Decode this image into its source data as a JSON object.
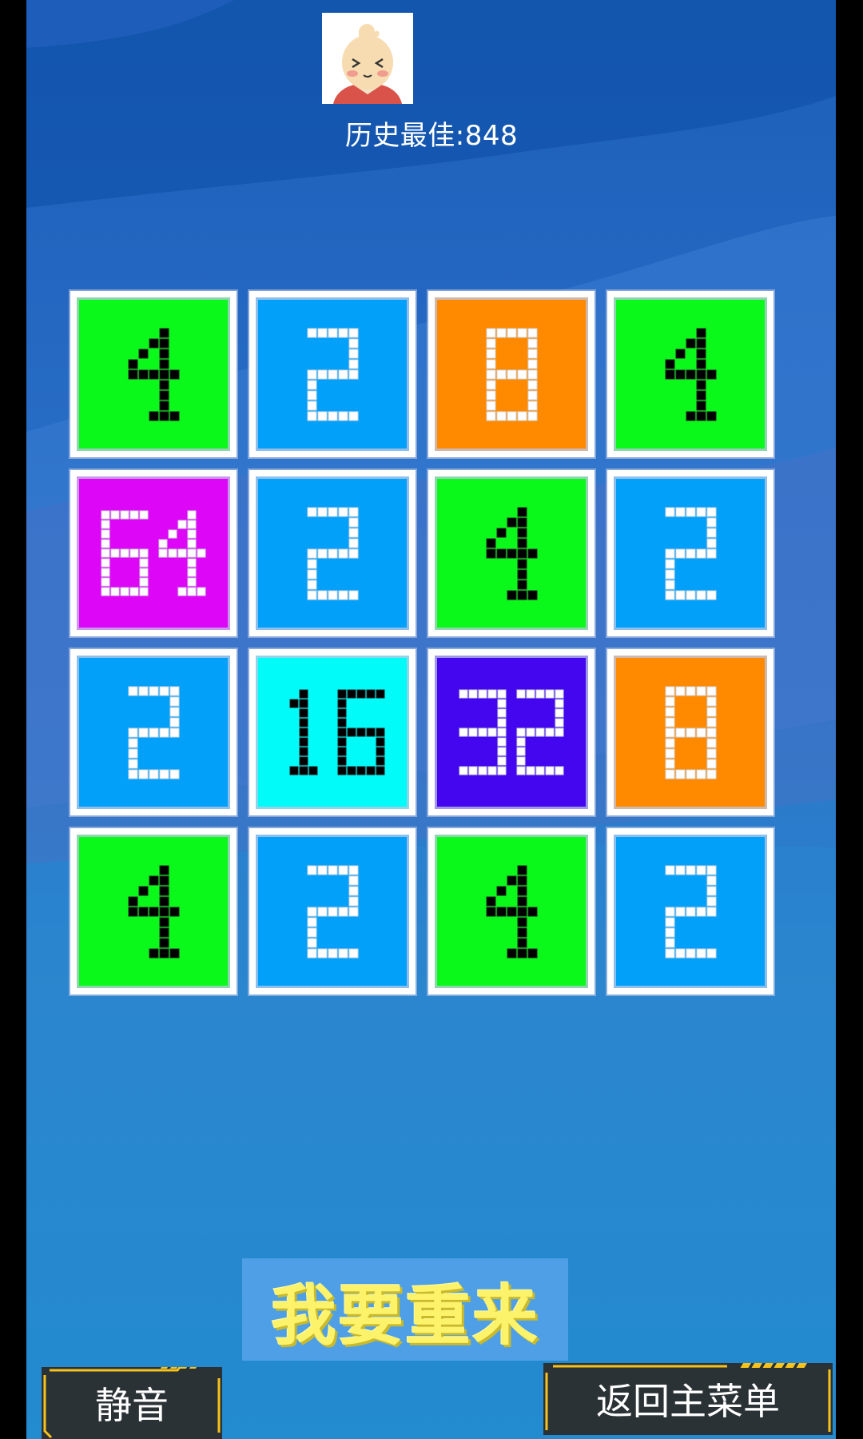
{
  "header": {
    "best_score_label": "历史最佳:848",
    "avatar_icon": "cartoon-boy-avatar-icon"
  },
  "board": {
    "rows": [
      [
        4,
        2,
        8,
        4
      ],
      [
        64,
        2,
        4,
        2
      ],
      [
        2,
        16,
        32,
        8
      ],
      [
        4,
        2,
        4,
        2
      ]
    ],
    "tile_colors": {
      "2": {
        "bg": "#03a0fa",
        "fg": "#ffffff"
      },
      "4": {
        "bg": "#0bf81b",
        "fg": "#000000"
      },
      "8": {
        "bg": "#ff8a00",
        "fg": "#ffffff"
      },
      "16": {
        "bg": "#00fbf8",
        "fg": "#000000"
      },
      "32": {
        "bg": "#4306ee",
        "fg": "#ffffff"
      },
      "64": {
        "bg": "#de06f7",
        "fg": "#ffffff"
      }
    }
  },
  "actions": {
    "restart_label": "我要重来",
    "mute_label": "静音",
    "main_menu_label": "返回主菜单"
  },
  "colors": {
    "restart_text": "#fdf36b",
    "restart_bg": "#4e9fe6",
    "hud_button_bg": "#2b3236",
    "hud_accent": "#f6c21b"
  }
}
